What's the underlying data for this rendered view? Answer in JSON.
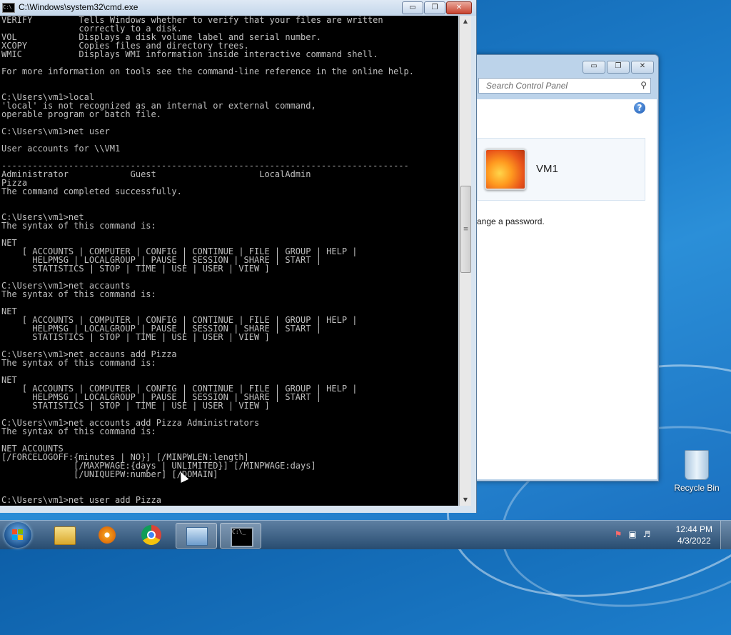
{
  "cmd": {
    "title": "C:\\Windows\\system32\\cmd.exe",
    "minimize": "▭",
    "restore": "❐",
    "close": "✕",
    "icon_text": "C:\\",
    "lines": [
      "VERIFY         Tells Windows whether to verify that your files are written",
      "               correctly to a disk.",
      "VOL            Displays a disk volume label and serial number.",
      "XCOPY          Copies files and directory trees.",
      "WMIC           Displays WMI information inside interactive command shell.",
      "",
      "For more information on tools see the command-line reference in the online help.",
      "",
      "",
      "C:\\Users\\vm1>local",
      "'local' is not recognized as an internal or external command,",
      "operable program or batch file.",
      "",
      "C:\\Users\\vm1>net user",
      "",
      "User accounts for \\\\VM1",
      "",
      "-------------------------------------------------------------------------------",
      "Administrator            Guest                    LocalAdmin",
      "Pizza",
      "The command completed successfully.",
      "",
      "",
      "C:\\Users\\vm1>net",
      "The syntax of this command is:",
      "",
      "NET",
      "    [ ACCOUNTS | COMPUTER | CONFIG | CONTINUE | FILE | GROUP | HELP |",
      "      HELPMSG | LOCALGROUP | PAUSE | SESSION | SHARE | START |",
      "      STATISTICS | STOP | TIME | USE | USER | VIEW ]",
      "",
      "C:\\Users\\vm1>net accaunts",
      "The syntax of this command is:",
      "",
      "NET",
      "    [ ACCOUNTS | COMPUTER | CONFIG | CONTINUE | FILE | GROUP | HELP |",
      "      HELPMSG | LOCALGROUP | PAUSE | SESSION | SHARE | START |",
      "      STATISTICS | STOP | TIME | USE | USER | VIEW ]",
      "",
      "C:\\Users\\vm1>net accauns add Pizza",
      "The syntax of this command is:",
      "",
      "NET",
      "    [ ACCOUNTS | COMPUTER | CONFIG | CONTINUE | FILE | GROUP | HELP |",
      "      HELPMSG | LOCALGROUP | PAUSE | SESSION | SHARE | START |",
      "      STATISTICS | STOP | TIME | USE | USER | VIEW ]",
      "",
      "C:\\Users\\vm1>net accounts add Pizza Administrators",
      "The syntax of this command is:",
      "",
      "NET ACCOUNTS",
      "[/FORCELOGOFF:{minutes | NO}] [/MINPWLEN:length]",
      "              [/MAXPWAGE:{days | UNLIMITED}] [/MINPWAGE:days]",
      "              [/UNIQUEPW:number] [/DOMAIN]",
      "",
      "",
      "C:\\Users\\vm1>net user add Pizza"
    ]
  },
  "control_panel": {
    "search_placeholder": "Search Control Panel",
    "minimize": "▭",
    "restore": "❐",
    "close": "✕",
    "help": "?",
    "user_name": "VM1",
    "link_text": "ange a password."
  },
  "desktop": {
    "recycle_bin_label": "Recycle Bin"
  },
  "taskbar": {
    "items": [
      "explorer",
      "media-player",
      "chrome",
      "control-panel",
      "cmd"
    ],
    "time": "12:44 PM",
    "date": "4/3/2022"
  }
}
